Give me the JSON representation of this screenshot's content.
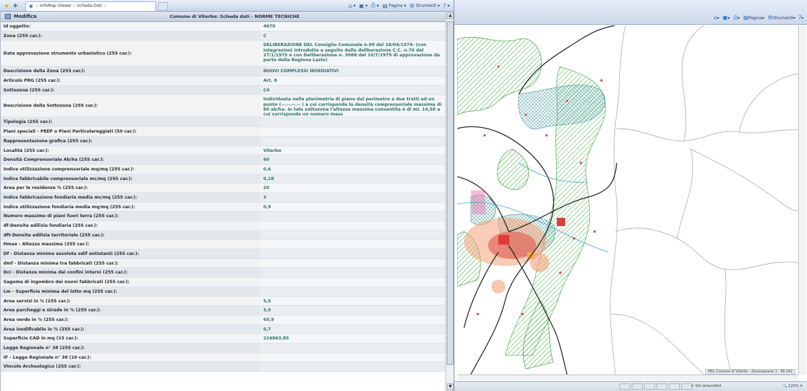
{
  "browser": {
    "tab_title": ":: InfoMap Viewer :: Scheda Dati ::",
    "tools": [
      "Pagina",
      "Strumenti"
    ]
  },
  "header": {
    "edit_label": "Modifica",
    "title": "Comune di Viterbo: Scheda dati - NORME TECNICHE"
  },
  "rows": [
    {
      "label": "Id oggetto:",
      "value": "4670"
    },
    {
      "label": "Zona (255 car.):",
      "value": "C"
    },
    {
      "label": "Data approvazione strumento urbanistico (255 car.):",
      "value": "DELIBERAZIONE DEL Consiglio Comunale n.99 del 18/04/1974- (con integrazioni introdotte a seguito della deliberazione C.C. n.76 del 27/1/1975 e con Deliberazione n. 3068 del 10/7/1979 di approvazione da parte della Regione Lazio)"
    },
    {
      "label": "Descrizione della Zona (255 car.):",
      "value": "NUOVI COMPLESSI INSEDIATIVI"
    },
    {
      "label": "Articolo PRG (255 car.):",
      "value": "Art. 8"
    },
    {
      "label": "Sottozona (255 car.):",
      "value": "C4"
    },
    {
      "label": "Descrizione della Sottozona (255 car.):",
      "value": "Individuata nella planimetria di piano dal perimetro a due tratti ed un punto (--.--.--.-- ) a cui corrisponde la densità comprensoriale massima di 60 ab/ha. In tale sottozona l'altezza massima consentita è di ml. 14,50 a cui corrisponde un numero mass"
    },
    {
      "label": "Tipologia (255 car.):",
      "value": ""
    },
    {
      "label": "Piani speciali - PEEP o Piani Particolareggiati (50 car.):",
      "value": ""
    },
    {
      "label": "Rappresentazione grafica (255 car.):",
      "value": ""
    },
    {
      "label": "Località (255 car.):",
      "value": "Viterbo"
    },
    {
      "label": "Densità Comprensoriale Ab/ha (255 car.):",
      "value": "60"
    },
    {
      "label": "Indice utilizzazione comprensoriale mq/mq (255 car.):",
      "value": "0,6"
    },
    {
      "label": "Indice fabbricabile comprensoriale mc/mq (255 car.):",
      "value": "0,18"
    },
    {
      "label": "Area per le residenze % (255 car.):",
      "value": "20"
    },
    {
      "label": "Indice fabbricazione fondiaria media mc/mq (255 car.):",
      "value": "3"
    },
    {
      "label": "Indice utilizzazione fondiaria media mq/mq (255 car.):",
      "value": "0,9"
    },
    {
      "label": "Numero massimo di piani fuori terra (255 car.):",
      "value": ""
    },
    {
      "label": "df-Densita edilizia fondiaria (255 car.):",
      "value": ""
    },
    {
      "label": "dft-Densita edilizia territoriale (255 car.):",
      "value": ""
    },
    {
      "label": "Hmax - Altezza massima (255 car.):",
      "value": ""
    },
    {
      "label": "Df - Distanza minima assoluta edif antistanti (255 car.):",
      "value": ""
    },
    {
      "label": "dmf - Distanza minima tra fabbricati (255 car.):",
      "value": ""
    },
    {
      "label": "Dci - Distanza minima dai confini interni (255 car.):",
      "value": ""
    },
    {
      "label": "Sagoma di ingombro dei nuovi fabbricati (255 car.):",
      "value": ""
    },
    {
      "label": "Lm - Superficie minima del lotto mq (255 car.):",
      "value": ""
    },
    {
      "label": "Area servizi in % (255 car.):",
      "value": "5,5"
    },
    {
      "label": "Area parcheggi e strade in % (255 car.):",
      "value": "3,9"
    },
    {
      "label": "Area verde in % (255 car.):",
      "value": "69,9"
    },
    {
      "label": "Area inedificabile in % (255 car.):",
      "value": "0,7"
    },
    {
      "label": "Superficie CAD in mq (15 car.):",
      "value": "216863,85"
    },
    {
      "label": "Legge Regionale n° 38 (255 car.):",
      "value": ""
    },
    {
      "label": "IF - Legge Regionale n° 38 (10 car.):",
      "value": ""
    },
    {
      "label": "Vincolo Archeologico (255 car.):",
      "value": ""
    }
  ],
  "map": {
    "tools": [
      "Pagina",
      "Strumenti"
    ],
    "zone_label": "PRG Comune di Viterbo - Zonizzazione",
    "scale_label": "1 : 90.242",
    "status_zone": "Siti attendibili",
    "zoom": "120%"
  }
}
